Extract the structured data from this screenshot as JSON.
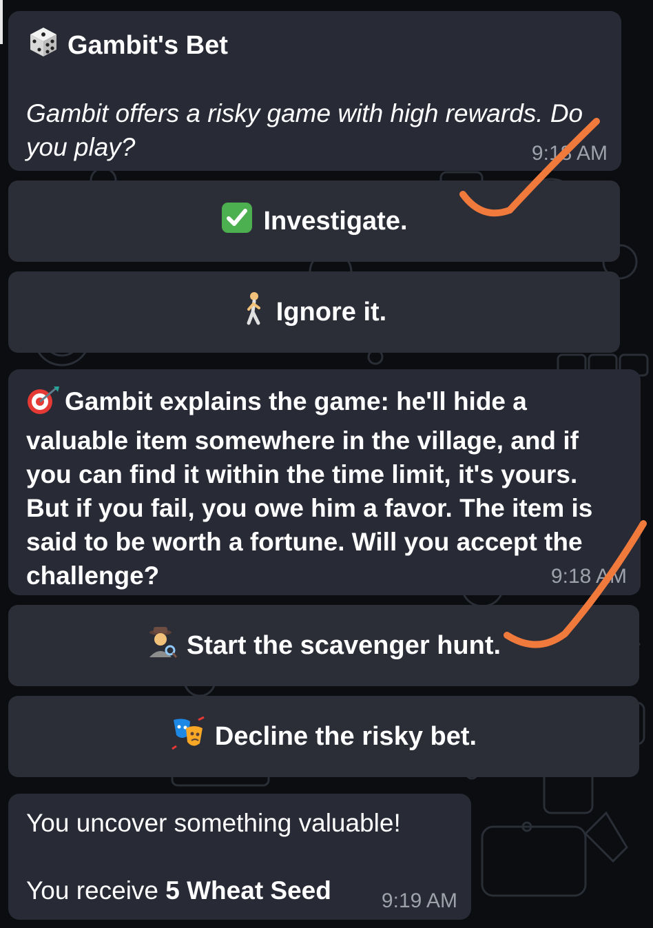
{
  "messages": {
    "gambit_bet": {
      "icon": "dice-icon",
      "title": "Gambit's Bet",
      "body": "Gambit offers a risky game with high rewards. Do you play?",
      "time": "9:18 AM"
    },
    "explanation": {
      "icon": "target-dart-icon",
      "body": "Gambit explains the game: he'll hide a valuable item somewhere in the village, and if you can find it within the time limit, it's yours. But if you fail, you owe him a favor. The item is said to be worth a fortune. Will you accept the challenge?",
      "time": "9:18 AM"
    },
    "result": {
      "line1": "You uncover something valuable!",
      "line2_prefix": "You receive",
      "line2_bold": "5 Wheat Seed",
      "time": "9:19 AM"
    }
  },
  "buttons": {
    "investigate": {
      "icon": "green-check-icon",
      "label": "Investigate."
    },
    "ignore": {
      "icon": "walking-person-icon",
      "label": "Ignore it."
    },
    "scavenger": {
      "icon": "detective-icon",
      "label": "Start the scavenger hunt."
    },
    "decline": {
      "icon": "theater-masks-icon",
      "label": "Decline the risky bet."
    }
  },
  "colors": {
    "background": "#0b0d10",
    "bubble": "#282a36",
    "timestamp": "#9ea2aa",
    "annotation_check": "#f07a3c"
  }
}
